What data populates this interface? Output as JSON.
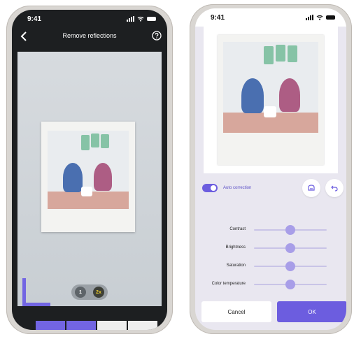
{
  "left_screen": {
    "status_time": "9:41",
    "title": "Remove reflections",
    "zoom_options": [
      "1",
      "2x"
    ],
    "selected_zoom": "2x",
    "progress_segments": [
      "filled",
      "filled",
      "empty",
      "empty"
    ],
    "colors": {
      "accent": "#7265e3",
      "segment_empty": "#eeeeee"
    }
  },
  "right_screen": {
    "status_time": "9:41",
    "auto_correction_label": "Auto correction",
    "auto_correction_on": true,
    "adjustments": [
      {
        "label": "Contrast",
        "value": 0.5
      },
      {
        "label": "Brightness",
        "value": 0.5
      },
      {
        "label": "Saturation",
        "value": 0.5
      },
      {
        "label": "Color temperature",
        "value": 0.5
      }
    ],
    "cancel_label": "Cancel",
    "ok_label": "OK",
    "colors": {
      "accent": "#6c5ddf"
    }
  }
}
